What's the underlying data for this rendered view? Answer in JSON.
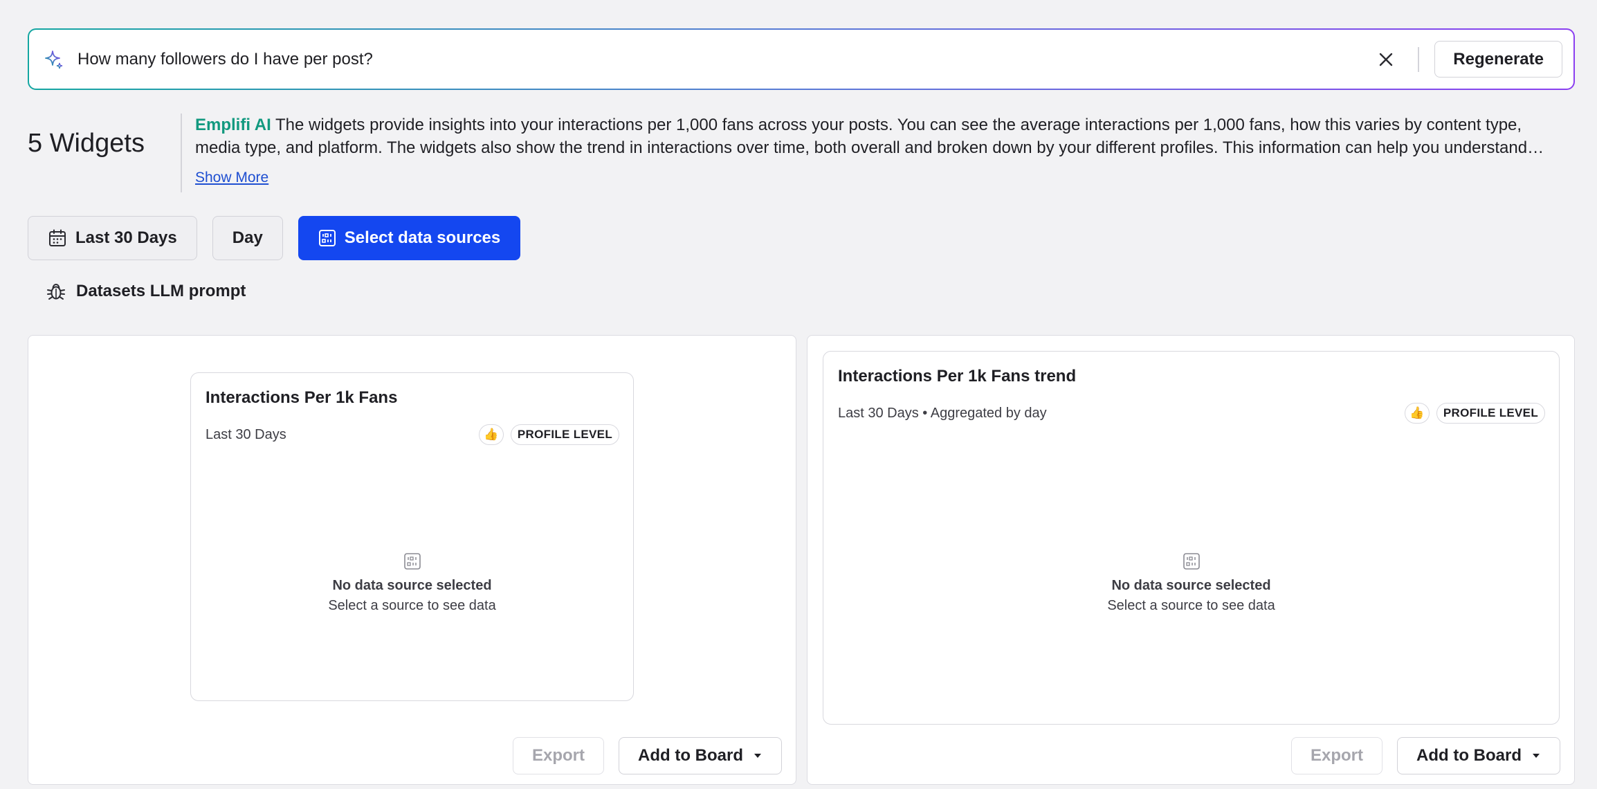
{
  "search": {
    "query": "How many followers do I have per post?",
    "regenerate_label": "Regenerate"
  },
  "summary": {
    "widgets_count": "5 Widgets",
    "brand": "Emplifi AI",
    "text": "The widgets provide insights into your interactions per 1,000 fans across your posts. You can see the average interactions per 1,000 fans, how this varies by content type, media type, and platform. The widgets also show the trend in interactions over time, both overall and broken down by your different profiles. This information can help you understand which content performs best and how engagement changes over time.",
    "show_more": "Show More"
  },
  "filters": {
    "date_range": "Last 30 Days",
    "granularity": "Day",
    "data_sources": "Select data sources"
  },
  "debug": {
    "llm_prompt": "Datasets LLM prompt"
  },
  "widgets": [
    {
      "title": "Interactions Per 1k Fans",
      "meta": "Last 30 Days",
      "badge_icon": "👍",
      "level": "PROFILE LEVEL",
      "empty_title": "No data source selected",
      "empty_sub": "Select a source to see data",
      "export_label": "Export",
      "add_label": "Add to Board"
    },
    {
      "title": "Interactions Per 1k Fans trend",
      "meta": "Last 30 Days • Aggregated by day",
      "badge_icon": "👍",
      "level": "PROFILE LEVEL",
      "empty_title": "No data source selected",
      "empty_sub": "Select a source to see data",
      "export_label": "Export",
      "add_label": "Add to Board"
    }
  ],
  "icons": {
    "sparkle": "sparkle-icon",
    "close": "close-icon",
    "calendar": "calendar-icon",
    "data_source": "data-source-icon",
    "bug": "bug-icon",
    "caret": "caret-down-icon"
  },
  "colors": {
    "brand_green": "#12997f",
    "primary_blue": "#1447f0",
    "link_blue": "#1f4fd1"
  }
}
